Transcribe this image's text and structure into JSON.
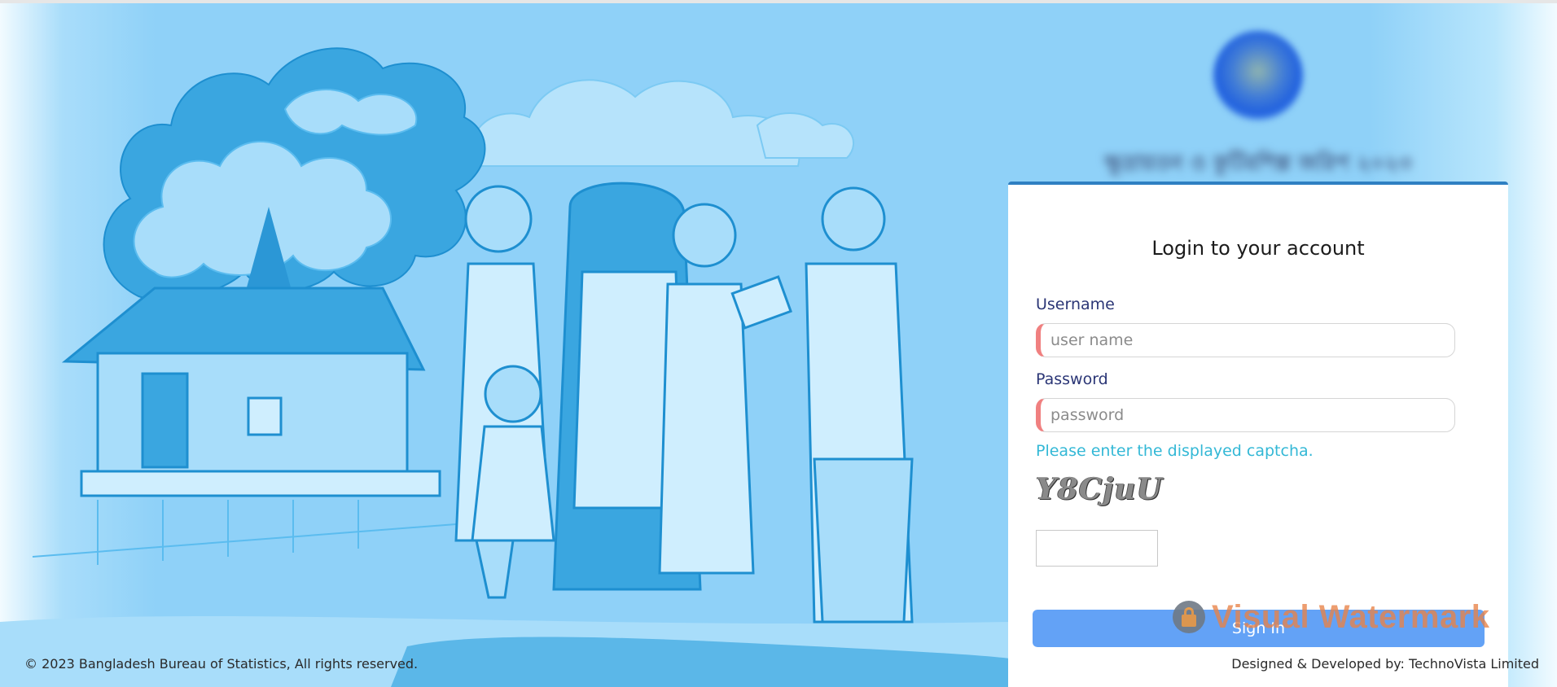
{
  "header": {
    "logo_text": "ক্ষুদ্রায়তন ও কুটিরশিল্প জরিপ ২০২৩"
  },
  "login": {
    "title": "Login to your account",
    "username_label": "Username",
    "username_placeholder": "user name",
    "password_label": "Password",
    "password_placeholder": "password",
    "captcha_hint": "Please enter the displayed captcha.",
    "captcha_text": "Y8CjuU",
    "captcha_value": "",
    "signin_label": "Sign In"
  },
  "watermark": {
    "text": "Visual Watermark",
    "icon": "lock-icon"
  },
  "footer": {
    "copyright": "© 2023 Bangladesh Bureau of Statistics, All rights reserved.",
    "credit": "Designed & Developed by: TechnoVista Limited"
  },
  "colors": {
    "background": "#8fd1f8",
    "card_top_border": "#2f80c2",
    "input_accent": "#f08080",
    "captcha_hint": "#33b8d6",
    "button": "#63a2f6",
    "label": "#2b3676"
  }
}
